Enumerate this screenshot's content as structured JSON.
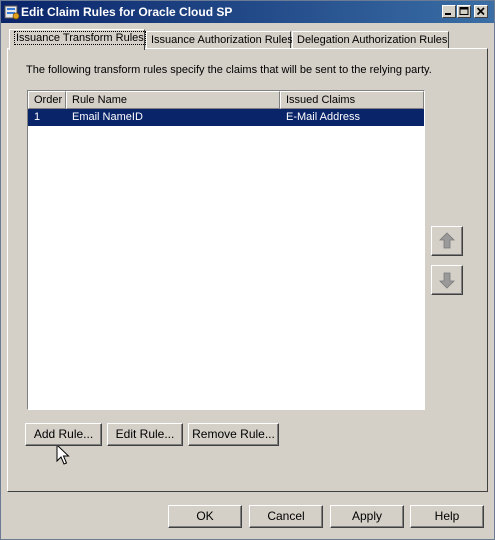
{
  "window": {
    "title": "Edit Claim Rules for Oracle Cloud SP",
    "icons": {
      "app": "claim-rules-app-icon",
      "minimize": "minimize-icon",
      "maximize": "maximize-icon",
      "close": "close-icon"
    }
  },
  "tabs": [
    {
      "label": "Issuance Transform Rules",
      "active": true
    },
    {
      "label": "Issuance Authorization Rules",
      "active": false
    },
    {
      "label": "Delegation Authorization Rules",
      "active": false
    }
  ],
  "panel": {
    "description": "The following transform rules specify the claims that will be sent to the relying party."
  },
  "rules_table": {
    "columns": [
      "Order",
      "Rule Name",
      "Issued Claims"
    ],
    "rows": [
      {
        "order": "1",
        "rule_name": "Email NameID",
        "issued_claims": "E-Mail Address",
        "selected": true
      }
    ]
  },
  "reorder": {
    "up_icon": "arrow-up-icon",
    "down_icon": "arrow-down-icon"
  },
  "rule_buttons": {
    "add": "Add Rule...",
    "edit": "Edit Rule...",
    "remove": "Remove Rule..."
  },
  "dialog_buttons": {
    "ok": "OK",
    "cancel": "Cancel",
    "apply": "Apply",
    "help": "Help"
  },
  "colors": {
    "title_bar": "#0a246a",
    "selection": "#0a246a",
    "face": "#d4d0c8"
  }
}
